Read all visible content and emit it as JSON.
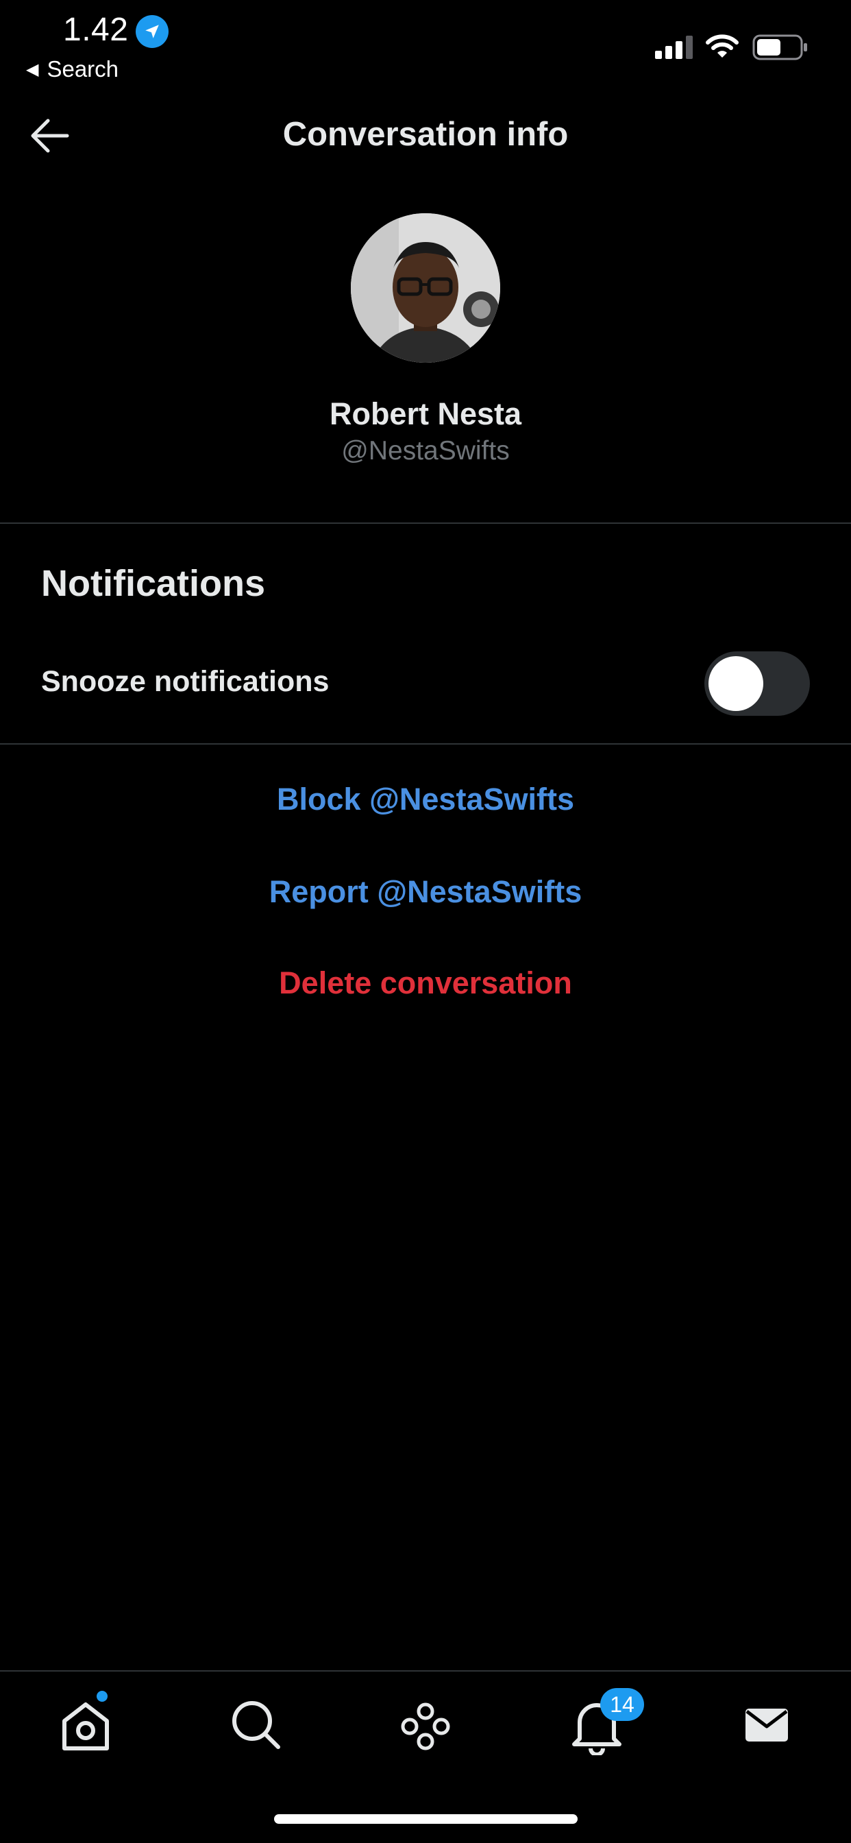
{
  "status_bar": {
    "time": "1.42",
    "back_label": "Search"
  },
  "header": {
    "title": "Conversation info"
  },
  "profile": {
    "name": "Robert Nesta",
    "handle": "@NestaSwifts"
  },
  "notifications": {
    "heading": "Notifications",
    "snooze_label": "Snooze notifications",
    "snooze_on": false
  },
  "actions": {
    "block": "Block @NestaSwifts",
    "report": "Report @NestaSwifts",
    "delete": "Delete conversation"
  },
  "tab_bar": {
    "notifications_badge": "14",
    "icons": [
      "home-icon",
      "search-icon",
      "spaces-icon",
      "bell-icon",
      "mail-icon"
    ]
  },
  "colors": {
    "background": "#000000",
    "text": "#e7e9ea",
    "secondary_text": "#71767b",
    "link_blue": "#4a90e2",
    "danger_red": "#e0303a",
    "accent": "#1d9bf0"
  }
}
